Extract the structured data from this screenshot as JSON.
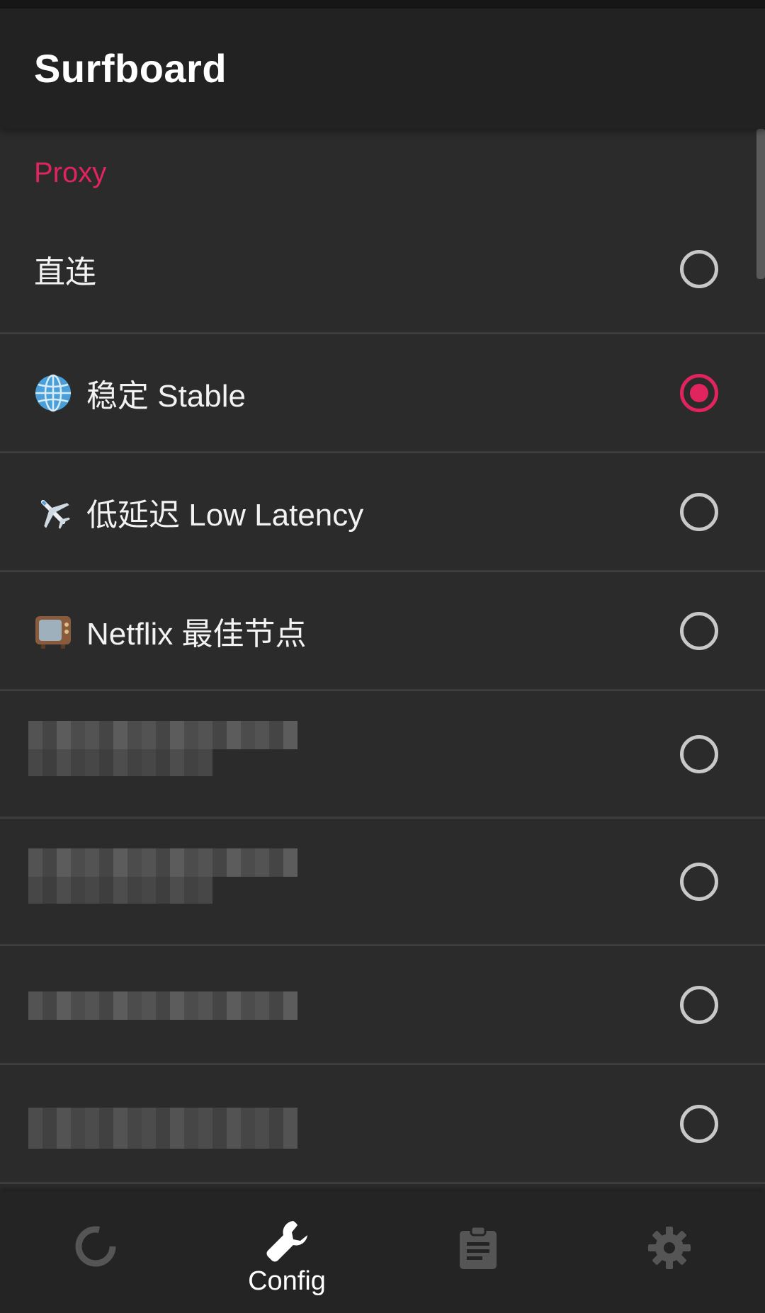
{
  "app": {
    "title": "Surfboard"
  },
  "proxy": {
    "section_title": "Proxy",
    "items": [
      {
        "label": "直连",
        "emoji": "",
        "selected": false
      },
      {
        "label": "稳定 Stable",
        "emoji": "globe-icon",
        "selected": true
      },
      {
        "label": "低延迟 Low Latency",
        "emoji": "airplane-icon",
        "selected": false
      },
      {
        "label": "Netflix 最佳节点",
        "emoji": "tv-icon",
        "selected": false
      },
      {
        "label": "",
        "redacted": true,
        "selected": false
      },
      {
        "label": "",
        "redacted": true,
        "selected": false
      },
      {
        "label": "",
        "redacted": true,
        "selected": false
      },
      {
        "label": "",
        "redacted": true,
        "selected": false
      }
    ]
  },
  "bottom_nav": {
    "items": [
      {
        "icon": "activity-ring-icon",
        "label": ""
      },
      {
        "icon": "wrench-icon",
        "label": "Config",
        "active": true
      },
      {
        "icon": "clipboard-icon",
        "label": ""
      },
      {
        "icon": "gear-icon",
        "label": ""
      }
    ]
  },
  "colors": {
    "accent": "#e0245e",
    "background": "#2b2b2b",
    "appbar": "#222222"
  }
}
